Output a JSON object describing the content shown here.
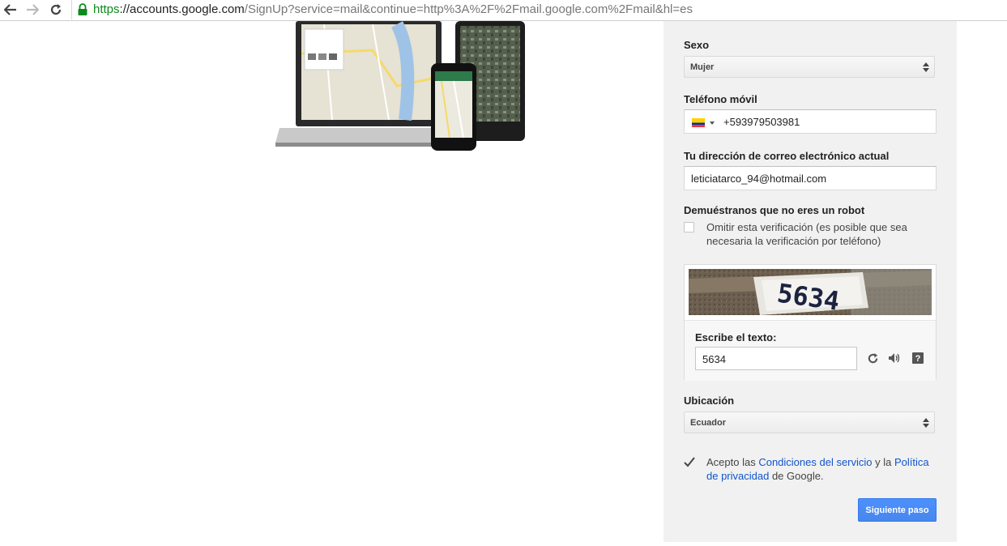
{
  "browser": {
    "url_scheme": "https",
    "url_host": "://accounts.google.com",
    "url_rest": "/SignUp?service=mail&continue=http%3A%2F%2Fmail.google.com%2Fmail&hl=es",
    "icons": [
      "back-icon",
      "forward-icon",
      "reload-icon",
      "lock-icon"
    ]
  },
  "form": {
    "gender": {
      "label": "Sexo",
      "value": "Mujer"
    },
    "phone": {
      "label": "Teléfono móvil",
      "value": "+593979503981",
      "flag": "ecuador-flag-icon"
    },
    "email": {
      "label": "Tu dirección de correo electrónico actual",
      "value": "leticiatarco_94@hotmail.com"
    },
    "robot": {
      "label": "Demuéstranos que no eres un robot",
      "skip_text": "Omitir esta verificación (es posible que sea necesaria la verificación por teléfono)",
      "skip_checked": false
    },
    "captcha": {
      "image_text": "5634",
      "prompt": "Escribe el texto:",
      "value": "5634",
      "icons": [
        "refresh-icon",
        "audio-icon",
        "help-icon"
      ]
    },
    "location": {
      "label": "Ubicación",
      "value": "Ecuador"
    },
    "terms": {
      "checked": true,
      "prefix": "Acepto las ",
      "terms_link": "Condiciones del servicio",
      "middle": " y la ",
      "privacy_link": "Política de privacidad",
      "suffix": " de Google."
    },
    "next_button": "Siguiente paso"
  },
  "colors": {
    "accent": "#4d90fe",
    "link": "#1155cc",
    "panel_bg": "#f1f1f1",
    "secure_green": "#0b8a1d"
  }
}
